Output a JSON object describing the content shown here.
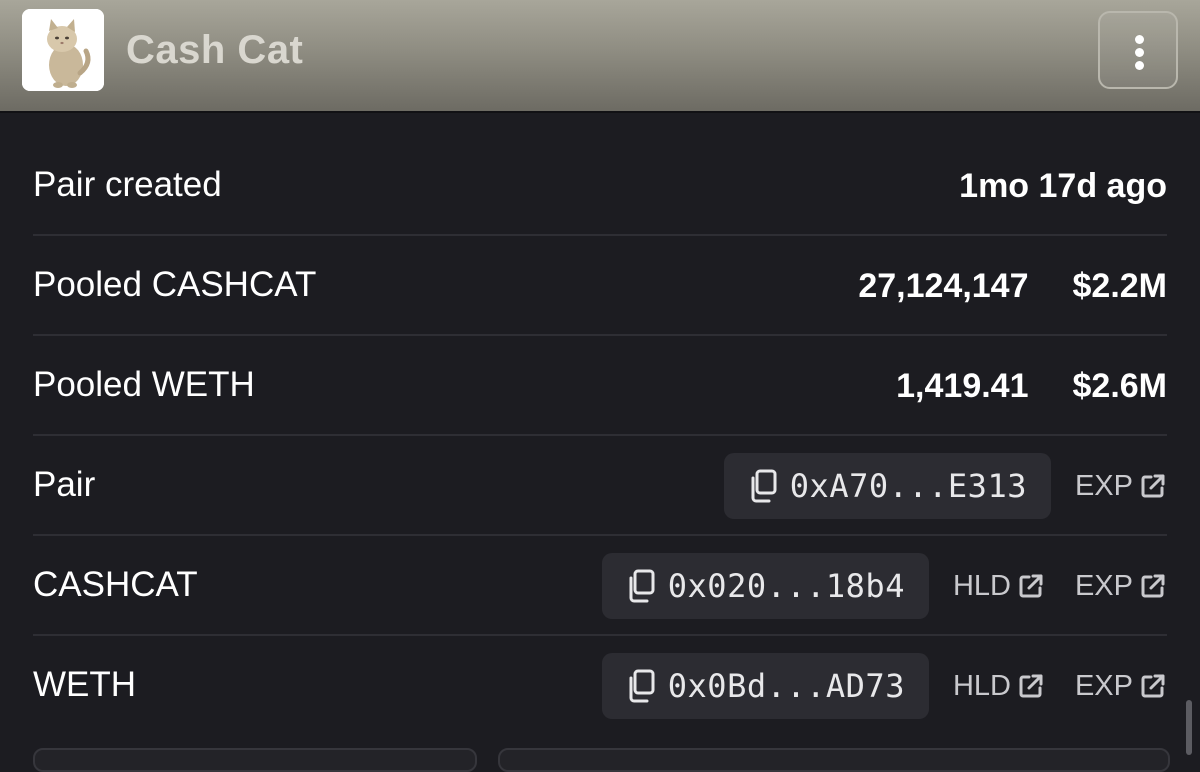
{
  "header": {
    "title": "Cash Cat",
    "avatar_icon": "cat-avatar-icon",
    "menu_icon": "more-vertical-icon"
  },
  "rows": {
    "pair_created": {
      "label": "Pair created",
      "value": "1mo 17d ago"
    },
    "pooled_token": {
      "label": "Pooled CASHCAT",
      "amount": "27,124,147",
      "usd": "$2.2M"
    },
    "pooled_weth": {
      "label": "Pooled WETH",
      "amount": "1,419.41",
      "usd": "$2.6M"
    },
    "pair": {
      "label": "Pair",
      "address": "0xA70...E313",
      "exp_label": "EXP"
    },
    "token": {
      "label": "CASHCAT",
      "address": "0x020...18b4",
      "hld_label": "HLD",
      "exp_label": "EXP"
    },
    "weth": {
      "label": "WETH",
      "address": "0x0Bd...AD73",
      "hld_label": "HLD",
      "exp_label": "EXP"
    }
  },
  "colors": {
    "background": "#1c1c21",
    "chip": "#2c2c32",
    "divider": "#2e2e34",
    "link_text": "#c9c9cd"
  }
}
